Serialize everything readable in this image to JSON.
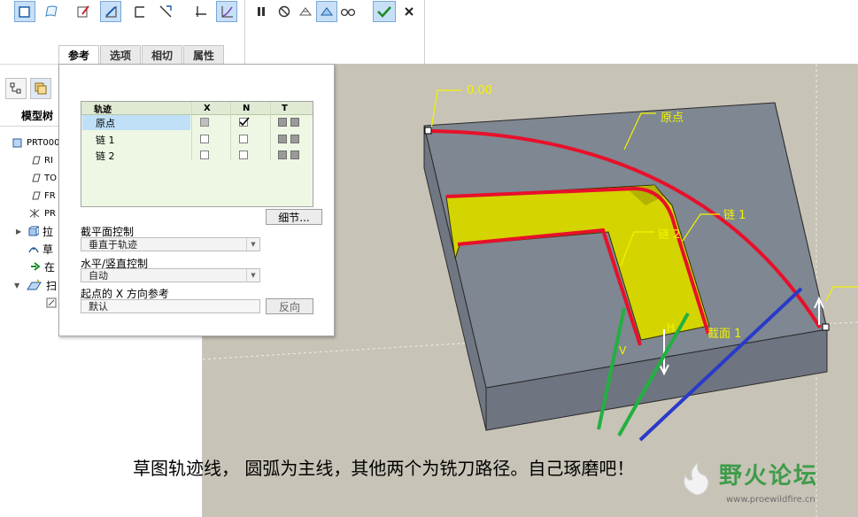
{
  "ribbon": {
    "pause_icon": "pause-icon",
    "confirm_icon": "checkmark-icon",
    "cancel_icon": "close-icon"
  },
  "dashboard_tabs": [
    {
      "label": "参考",
      "active": true
    },
    {
      "label": "选项",
      "active": false
    },
    {
      "label": "相切",
      "active": false
    },
    {
      "label": "属性",
      "active": false
    }
  ],
  "reference_panel": {
    "table": {
      "headers": [
        "轨迹",
        "X",
        "N",
        "T"
      ],
      "rows": [
        {
          "name": "原点",
          "x_disabled": true,
          "n_checked": true,
          "selected": true
        },
        {
          "name": "链 1",
          "x_disabled": false,
          "n_checked": false,
          "selected": false
        },
        {
          "name": "链 2",
          "x_disabled": false,
          "n_checked": false,
          "selected": false
        }
      ]
    },
    "details_button": "细节...",
    "section_plane_label": "截平面控制",
    "section_plane_value": "垂直于轨迹",
    "hv_label": "水平/竖直控制",
    "hv_value": "自动",
    "x_dir_label": "起点的 X 方向参考",
    "x_dir_value": "默认",
    "flip_button": "反向"
  },
  "model_tree": {
    "title": "模型树",
    "items": [
      {
        "label": "PRT000"
      },
      {
        "label": "RI"
      },
      {
        "label": "TO"
      },
      {
        "label": "FR"
      },
      {
        "label": "PR"
      },
      {
        "label": "拉"
      },
      {
        "label": "草"
      },
      {
        "label": "在"
      },
      {
        "label": "扫"
      }
    ]
  },
  "viewport_labels": {
    "dimension": "0.00",
    "origin": "原点",
    "chain1": "链 1",
    "chain2": "链 2",
    "section": "截面 1",
    "h_mark": "H",
    "v_mark": "V"
  },
  "caption": "草图轨迹线， 圆弧为主线，其他两个为铣刀路径。自己琢磨吧！",
  "watermark": {
    "title": "野火论坛",
    "url": "www.proewildfire.cn"
  },
  "colors": {
    "trajectory_red": "#e8102a",
    "sweep_yellow": "#d4d400",
    "block_top": "#7e8792",
    "viewport_bg": "#c7c3b6",
    "annotation_yellow": "#f3f300",
    "cutter_green": "#22b040",
    "cutter_blue": "#2a3ac8"
  }
}
